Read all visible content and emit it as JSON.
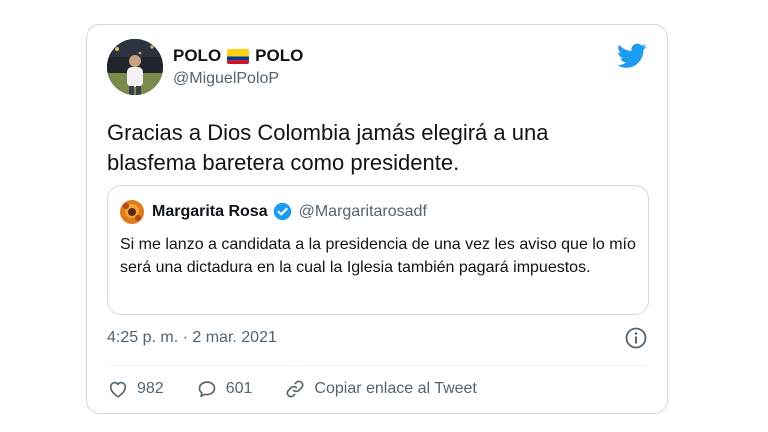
{
  "tweet": {
    "author": {
      "name_left": "POLO",
      "name_right": "POLO",
      "flag_icon": "colombia-flag-icon",
      "handle": "@MiguelPoloP"
    },
    "text": "Gracias a Dios Colombia jamás elegirá a una\nblasfema baretera como presidente.",
    "quoted": {
      "name": "Margarita Rosa",
      "handle": "@Margaritarosadf",
      "verified": true,
      "text": "Si me lanzo a candidata a la presidencia de una vez les aviso que lo mío será una dictadura en la cual la Iglesia también pagará impuestos."
    },
    "timestamp": "4:25 p. m. · 2 mar. 2021",
    "likes": "982",
    "replies": "601",
    "copy_link_label": "Copiar enlace al Tweet"
  },
  "colors": {
    "twitter_blue": "#1d9bf0",
    "text_primary": "#0f1419",
    "text_secondary": "#536471",
    "border": "#cfd9de"
  }
}
